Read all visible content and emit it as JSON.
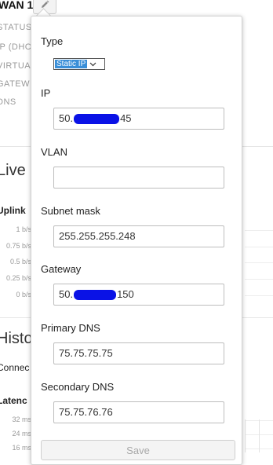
{
  "background": {
    "title": "WAN 1",
    "labels": [
      "STATUS",
      "IP (DHC",
      "VIRTUA",
      "GATEW",
      "DNS"
    ],
    "section_live": "Live c",
    "uplink_label": "Uplink",
    "chart_ticks": [
      "1 b/s",
      "0.75 b/s",
      "0.5 b/s",
      "0.25 b/s",
      "0 b/s"
    ],
    "section_history": "Histo",
    "connection_label": "Connec",
    "latency_label": "Latenc",
    "latency_ticks": [
      "32 ms",
      "24 ms",
      "16 ms"
    ]
  },
  "panel": {
    "type": {
      "label": "Type",
      "value": "Static IP"
    },
    "ip": {
      "label": "IP",
      "prefix": "50.",
      "suffix": "45"
    },
    "vlan": {
      "label": "VLAN",
      "value": ""
    },
    "subnet": {
      "label": "Subnet mask",
      "value": "255.255.255.248"
    },
    "gateway": {
      "label": "Gateway",
      "prefix": "50.",
      "suffix": "150"
    },
    "primary_dns": {
      "label": "Primary DNS",
      "value": "75.75.75.75"
    },
    "secondary_dns": {
      "label": "Secondary DNS",
      "value": "75.75.76.76"
    },
    "save_label": "Save"
  },
  "colors": {
    "redaction": "#0a12e6",
    "select_highlight": "#3a8fd8"
  },
  "icons": {
    "edit": "pencil-icon",
    "select": "chevron-down-icon"
  }
}
